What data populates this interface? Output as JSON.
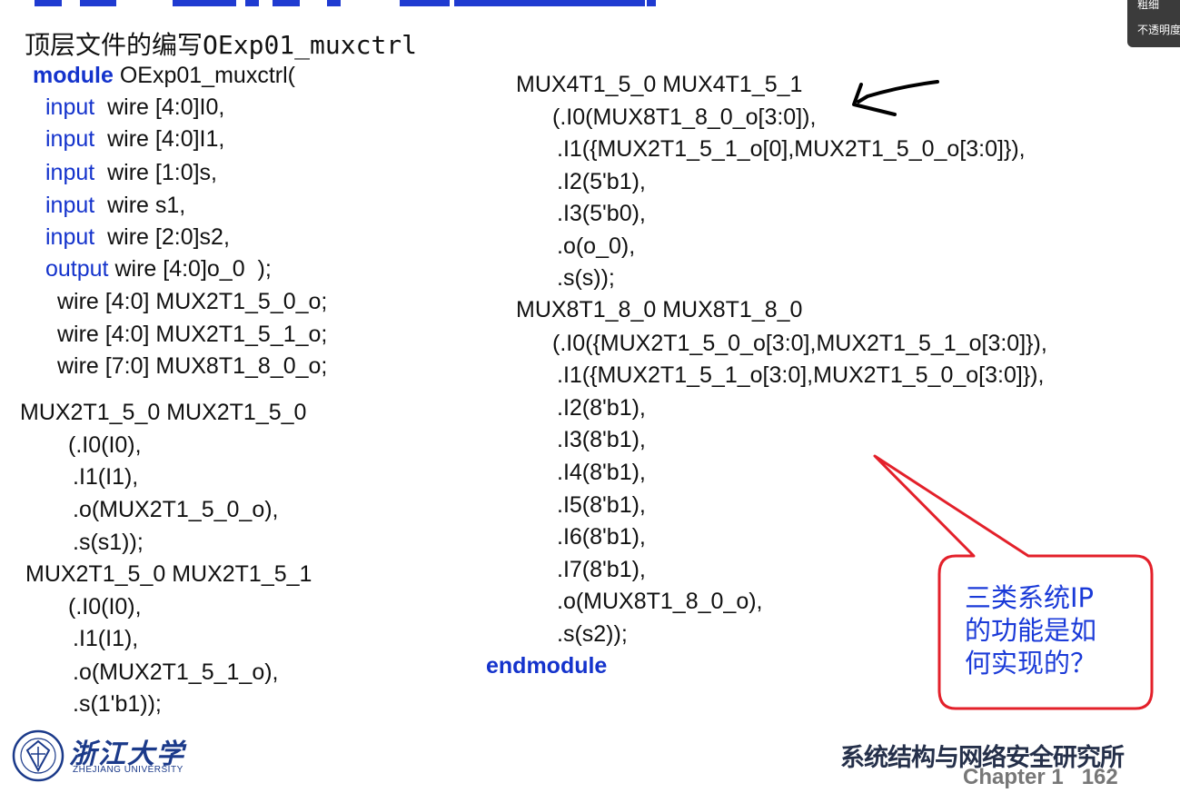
{
  "title_bar": {
    "color": "#1f3bd1"
  },
  "tool_panel": {
    "line1": "粗细",
    "line2": "不透明度"
  },
  "heading": {
    "cn": "顶层文件的编写",
    "code": "OExp01_muxctrl"
  },
  "code_left": [
    [
      "module",
      " OExp01_muxctrl("
    ],
    [
      "input",
      "  wire [4:0]I0,"
    ],
    [
      "input",
      "  wire [4:0]I1,"
    ],
    [
      "input",
      "  wire [1:0]s,"
    ],
    [
      "input",
      "  wire s1,"
    ],
    [
      "input",
      "  wire [2:0]s2,"
    ],
    [
      "output",
      " wire [4:0]o_0  );"
    ],
    [
      "",
      "wire [4:0] MUX2T1_5_0_o;"
    ],
    [
      "",
      "wire [4:0] MUX2T1_5_1_o;"
    ],
    [
      "",
      "wire [7:0] MUX8T1_8_0_o;"
    ],
    [
      "",
      "MUX2T1_5_0 MUX2T1_5_0"
    ],
    [
      "",
      "(.I0(I0),"
    ],
    [
      "",
      ".I1(I1),"
    ],
    [
      "",
      ".o(MUX2T1_5_0_o),"
    ],
    [
      "",
      ".s(s1));"
    ],
    [
      "",
      "MUX2T1_5_0 MUX2T1_5_1"
    ],
    [
      "",
      "(.I0(I0),"
    ],
    [
      "",
      ".I1(I1),"
    ],
    [
      "",
      ".o(MUX2T1_5_1_o),"
    ],
    [
      "",
      ".s(1'b1));"
    ]
  ],
  "code_right": [
    "MUX4T1_5_0 MUX4T1_5_1",
    "(.I0(MUX8T1_8_0_o[3:0]),",
    ".I1({MUX2T1_5_1_o[0],MUX2T1_5_0_o[3:0]}),",
    ".I2(5'b1),",
    ".I3(5'b0),",
    ".o(o_0),",
    ".s(s));",
    "MUX8T1_8_0 MUX8T1_8_0",
    "(.I0({MUX2T1_5_0_o[3:0],MUX2T1_5_1_o[3:0]}),",
    ".I1({MUX2T1_5_1_o[3:0],MUX2T1_5_0_o[3:0]}),",
    ".I2(8'b1),",
    ".I3(8'b1),",
    ".I4(8'b1),",
    ".I5(8'b1),",
    ".I6(8'b1),",
    ".I7(8'b1),",
    ".o(MUX8T1_8_0_o),",
    ".s(s2));",
    "endmodule"
  ],
  "callout": {
    "lines": [
      "三类系统IP",
      "的功能是如",
      "何实现的？"
    ],
    "border_color": "#e3202a",
    "text_color": "#1a3ad8"
  },
  "footer": {
    "logo_cn": "浙江大学",
    "logo_en": "ZHEJIANG UNIVERSITY",
    "institute": "系统结构与网络安全研究所",
    "chapter": "Chapter 1   162"
  }
}
